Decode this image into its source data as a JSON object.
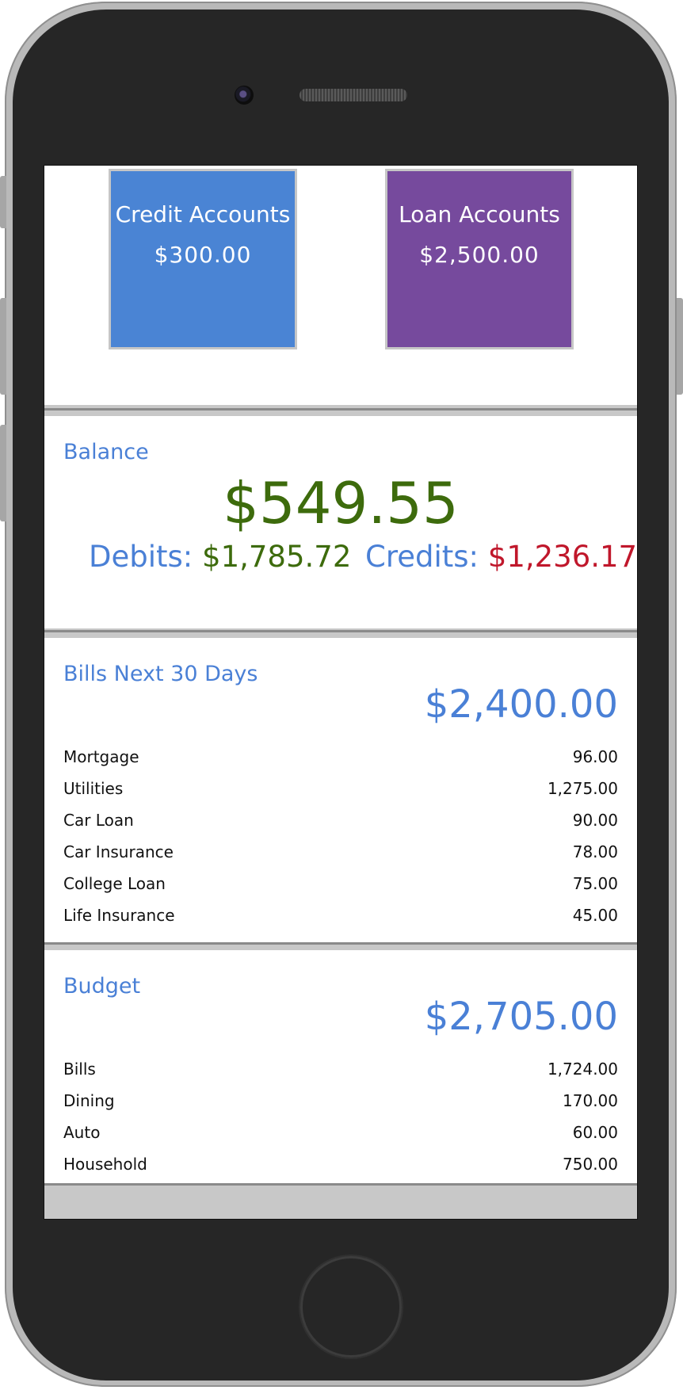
{
  "accounts": {
    "credit": {
      "title": "Credit Accounts",
      "amount": "$300.00",
      "color": "#4a84d4"
    },
    "loan": {
      "title": "Loan Accounts",
      "amount": "$2,500.00",
      "color": "#764a9d"
    }
  },
  "balance": {
    "title": "Balance",
    "amount": "$549.55",
    "debits_label": "Debits:",
    "debits_value": "$1,785.72",
    "credits_label": "Credits:",
    "credits_value": "$1,236.17"
  },
  "bills": {
    "title": "Bills Next 30 Days",
    "total": "$2,400.00",
    "items": [
      {
        "label": "Mortgage",
        "value": "96.00"
      },
      {
        "label": "Utilities",
        "value": "1,275.00"
      },
      {
        "label": "Car Loan",
        "value": "90.00"
      },
      {
        "label": "Car Insurance",
        "value": "78.00"
      },
      {
        "label": "College Loan",
        "value": "75.00"
      },
      {
        "label": "Life Insurance",
        "value": "45.00"
      }
    ]
  },
  "budget": {
    "title": "Budget",
    "total": "$2,705.00",
    "items": [
      {
        "label": "Bills",
        "value": "1,724.00"
      },
      {
        "label": "Dining",
        "value": "170.00"
      },
      {
        "label": "Auto",
        "value": "60.00"
      },
      {
        "label": "Household",
        "value": "750.00"
      }
    ]
  },
  "colors": {
    "accent_blue": "#4a80d6",
    "positive_green": "#3d6b0c",
    "negative_red": "#c0172b"
  },
  "icons": [
    "camera-icon",
    "speaker-grille",
    "home-button"
  ]
}
